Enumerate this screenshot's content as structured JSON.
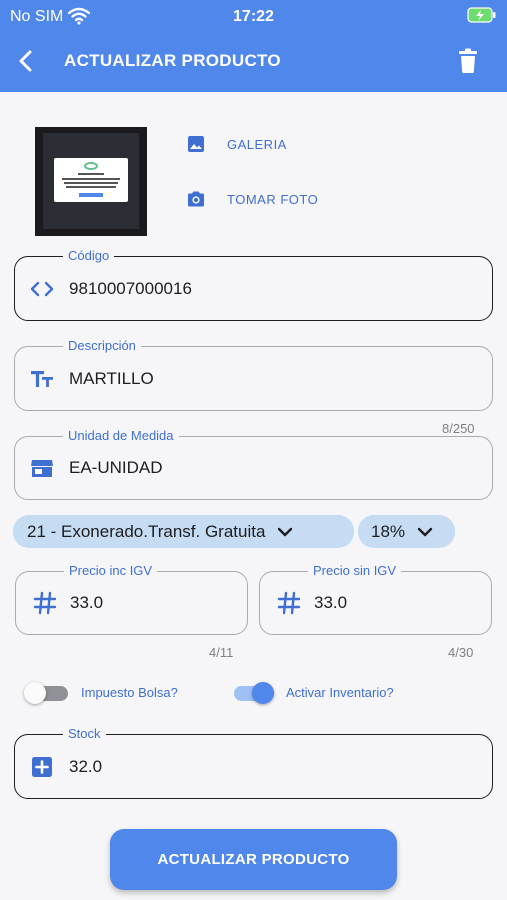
{
  "status_bar": {
    "carrier": "No SIM",
    "time": "17:22"
  },
  "header": {
    "title": "ACTUALIZAR PRODUCTO"
  },
  "media": {
    "gallery_label": "GALERIA",
    "camera_label": "TOMAR FOTO"
  },
  "fields": {
    "codigo": {
      "label": "Código",
      "value": "9810007000016"
    },
    "descripcion": {
      "label": "Descripción",
      "value": "MARTILLO",
      "counter": "8/250"
    },
    "unidad": {
      "label": "Unidad de Medida",
      "value": "EA-UNIDAD"
    },
    "precio_inc": {
      "label": "Precio inc IGV",
      "value": "33.0",
      "counter": "4/11"
    },
    "precio_sin": {
      "label": "Precio sin IGV",
      "value": "33.0",
      "counter": "4/30"
    },
    "stock": {
      "label": "Stock",
      "value": "32.0"
    }
  },
  "dropdowns": {
    "afectacion": "21 - Exonerado.Transf. Gratuita",
    "igv_rate": "18%"
  },
  "toggles": {
    "impuesto_bolsa": {
      "label": "Impuesto Bolsa?",
      "on": false
    },
    "activar_inventario": {
      "label": "Activar Inventario?",
      "on": true
    }
  },
  "actions": {
    "submit_label": "ACTUALIZAR PRODUCTO"
  },
  "colors": {
    "primary": "#4f87eb",
    "chip": "#c5dcf2",
    "label": "#3f6fd1",
    "background": "#f6f6f8"
  }
}
